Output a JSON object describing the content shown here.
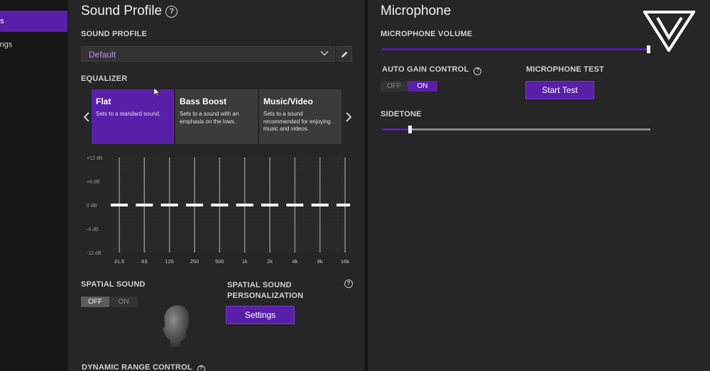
{
  "sidebar": {
    "items": [
      {
        "label": "gs",
        "active": true
      },
      {
        "label": "tings",
        "active": false
      }
    ]
  },
  "sound_profile": {
    "title": "Sound Profile",
    "profile_label": "SOUND PROFILE",
    "selected": "Default",
    "equalizer_label": "EQUALIZER",
    "presets": [
      {
        "title": "Flat",
        "desc": "Sets to a standard sound.",
        "active": true
      },
      {
        "title": "Bass Boost",
        "desc": "Sets to a sound with an emphasis on the lows.",
        "active": false
      },
      {
        "title": "Music/Video",
        "desc": "Sets to a sound recommended for enjoying music and videos.",
        "active": false
      }
    ],
    "eq": {
      "db_labels": [
        "+12 dB",
        "+6 dB",
        "0 dB",
        "-6 dB",
        "-12 dB"
      ],
      "bands": [
        "31.5",
        "63",
        "125",
        "250",
        "500",
        "1k",
        "2k",
        "4k",
        "8k",
        "16k"
      ],
      "gains_db": [
        0,
        0,
        0,
        0,
        0,
        0,
        0,
        0,
        0,
        0
      ]
    },
    "spatial_label": "SPATIAL SOUND",
    "spatial_toggle": {
      "off": "OFF",
      "on": "ON",
      "state": "off"
    },
    "spatial_personalization_label": "SPATIAL SOUND PERSONALIZATION",
    "settings_button": "Settings",
    "drc_label": "DYNAMIC RANGE CONTROL"
  },
  "microphone": {
    "title": "Microphone",
    "volume_label": "MICROPHONE VOLUME",
    "volume_level": 1.0,
    "agc_label": "AUTO GAIN CONTROL",
    "agc_toggle": {
      "off": "OFF",
      "on": "ON",
      "state": "on"
    },
    "test_label": "MICROPHONE TEST",
    "start_test": "Start Test",
    "sidetone_label": "SIDETONE",
    "sidetone_level": 0.1
  },
  "colors": {
    "accent": "#5a1fa8",
    "panel": "#262626",
    "sidebar": "#161616"
  }
}
